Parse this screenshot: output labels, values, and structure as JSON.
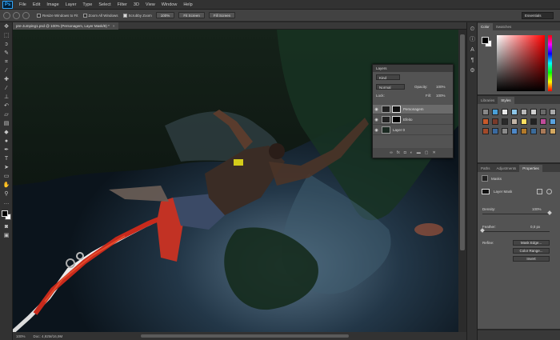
{
  "menubar": {
    "logo": "Ps",
    "items": [
      "File",
      "Edit",
      "Image",
      "Layer",
      "Type",
      "Select",
      "Filter",
      "3D",
      "View",
      "Window",
      "Help"
    ]
  },
  "options": {
    "resize_windows": "Resize Windows to Fit",
    "zoom_all": "Zoom All Windows",
    "scrubby_zoom": "Scrubby Zoom",
    "btn_100": "100%",
    "fit_screen": "Fit Screen",
    "fill_screen": "Fill Screen",
    "workspace": "Essentials"
  },
  "document": {
    "tab_title": "pre-Jumping1.psd @ 100% (Personagem, Layer Mask/8) *",
    "close": "×",
    "zoom": "100%",
    "doc_size": "Doc: 4,92M/16,9M"
  },
  "color_panel": {
    "tabs": [
      "Color",
      "Swatches"
    ]
  },
  "styles_panel": {
    "tabs": [
      "Libraries",
      "Styles"
    ]
  },
  "properties_panel": {
    "tabs": [
      "Paths",
      "Adjustments",
      "Properties"
    ],
    "masks_label": "Masks",
    "layer_mask": "Layer Mask",
    "density_label": "Density:",
    "density_value": "100%",
    "feather_label": "Feather:",
    "feather_value": "0,0 px",
    "refine_label": "Refine:",
    "mask_edge": "Mask Edge...",
    "color_range": "Color Range...",
    "invert": "Invert"
  },
  "layers_panel": {
    "title": "Layers",
    "kind": "Kind",
    "blend_mode": "Normal",
    "opacity_label": "Opacity:",
    "opacity_value": "100%",
    "lock_label": "Lock:",
    "fill_label": "Fill:",
    "fill_value": "100%",
    "layers": [
      {
        "name": "Personagem",
        "selected": true
      },
      {
        "name": "Efeito",
        "selected": false
      },
      {
        "name": "Layer 0",
        "selected": false
      }
    ]
  },
  "colors": {
    "accent": "#31a8ff",
    "panel_bg": "#535353",
    "chrome": "#323232"
  }
}
